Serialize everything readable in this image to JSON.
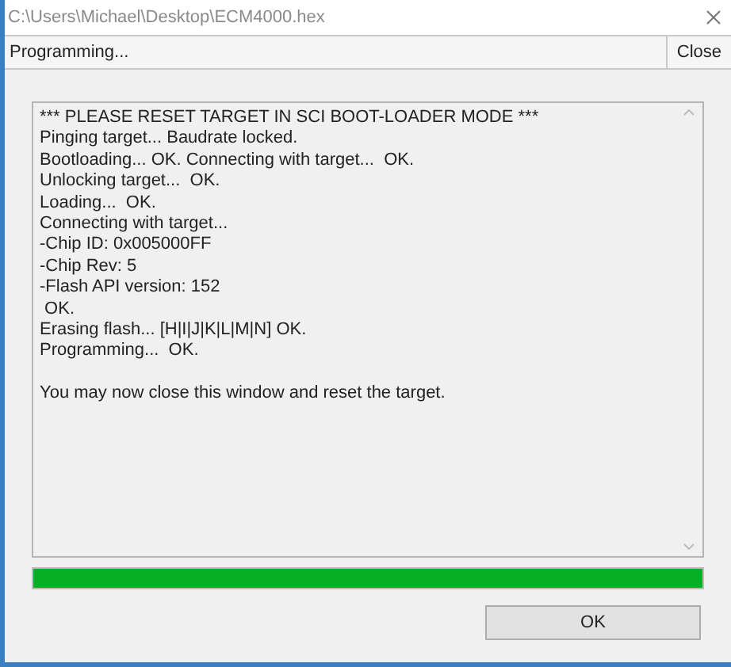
{
  "window": {
    "title": "C:\\Users\\Michael\\Desktop\\ECM4000.hex"
  },
  "toolbar": {
    "status": "Programming...",
    "close_label": "Close"
  },
  "log_paragraphs": [
    {
      "lines": [
        "*** PLEASE RESET TARGET IN SCI BOOT-LOADER MODE ***",
        "Pinging target... Baudrate locked.",
        "Bootloading... OK. Connecting with target...  OK.",
        "Unlocking target...  OK.",
        "Loading...  OK.",
        "Connecting with target...",
        "-Chip ID: 0x005000FF",
        "-Chip Rev: 5",
        "-Flash API version: 152",
        " OK.",
        "Erasing flash... [H|I|J|K|L|M|N] OK.",
        "Programming...  OK."
      ]
    },
    {
      "lines": [
        "You may now close this window and reset the target."
      ]
    }
  ],
  "progress": {
    "level": 1
  },
  "buttons": {
    "ok": "OK"
  }
}
